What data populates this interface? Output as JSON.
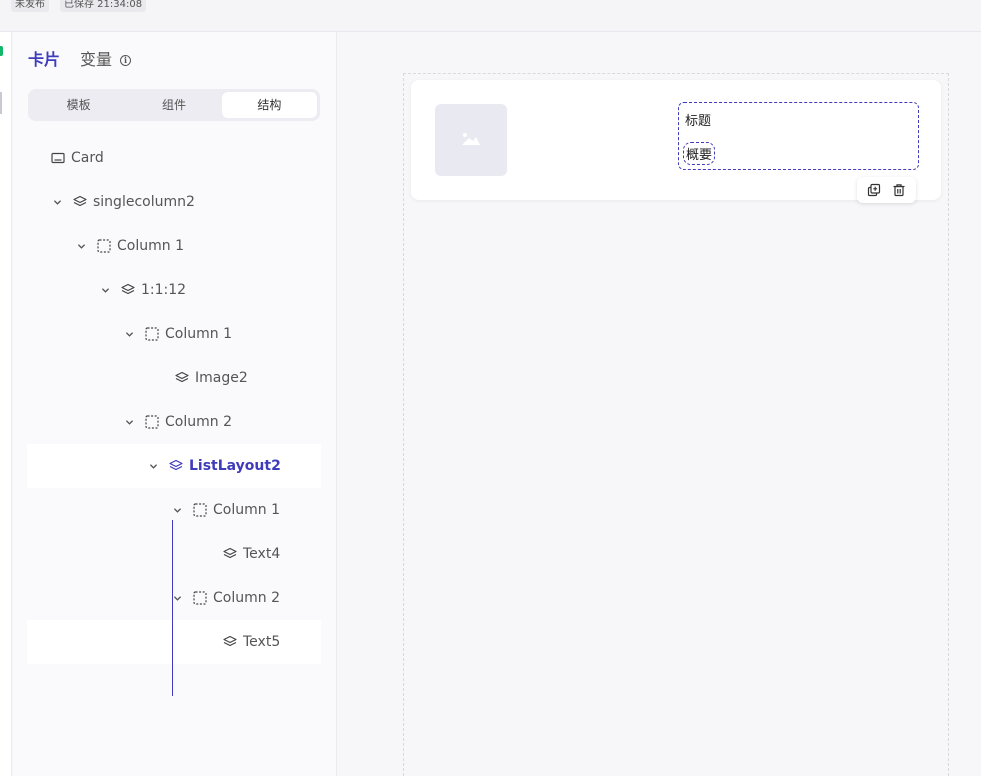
{
  "topbar": {
    "status_unpublished": "未发布",
    "status_saved": "已保存 21:34:08"
  },
  "panel": {
    "tabs": [
      {
        "label": "卡片",
        "active": true
      },
      {
        "label": "变量",
        "active": false
      }
    ],
    "info_icon": "info-circle-icon",
    "segments": [
      {
        "label": "模板",
        "active": false
      },
      {
        "label": "组件",
        "active": false
      },
      {
        "label": "结构",
        "active": true
      }
    ]
  },
  "tree": [
    {
      "label": "Card",
      "icon": "card-icon",
      "caret": false
    },
    {
      "label": "singlecolumn2",
      "icon": "layers-icon",
      "caret": true
    },
    {
      "label": "Column 1",
      "icon": "column-dashed-icon",
      "caret": true
    },
    {
      "label": "1:1:12",
      "icon": "layers-icon",
      "caret": true
    },
    {
      "label": "Column 1",
      "icon": "column-dashed-icon",
      "caret": true
    },
    {
      "label": "Image2",
      "icon": "layers-icon",
      "caret": false
    },
    {
      "label": "Column 2",
      "icon": "column-dashed-icon",
      "caret": true
    },
    {
      "label": "ListLayout2",
      "icon": "layers-icon",
      "caret": true,
      "selected": true
    },
    {
      "label": "Column 1",
      "icon": "column-dashed-icon",
      "caret": true
    },
    {
      "label": "Text4",
      "icon": "layers-icon",
      "caret": false
    },
    {
      "label": "Column 2",
      "icon": "column-dashed-icon",
      "caret": true
    },
    {
      "label": "Text5",
      "icon": "layers-icon",
      "caret": false
    }
  ],
  "canvas": {
    "card_title": "标题",
    "card_summary": "概要",
    "image_placeholder_icon": "image-placeholder-icon",
    "actions": [
      {
        "name": "copy-icon"
      },
      {
        "name": "trash-icon"
      }
    ]
  },
  "colors": {
    "accent": "#3f3cbb",
    "green": "#12b76a"
  }
}
